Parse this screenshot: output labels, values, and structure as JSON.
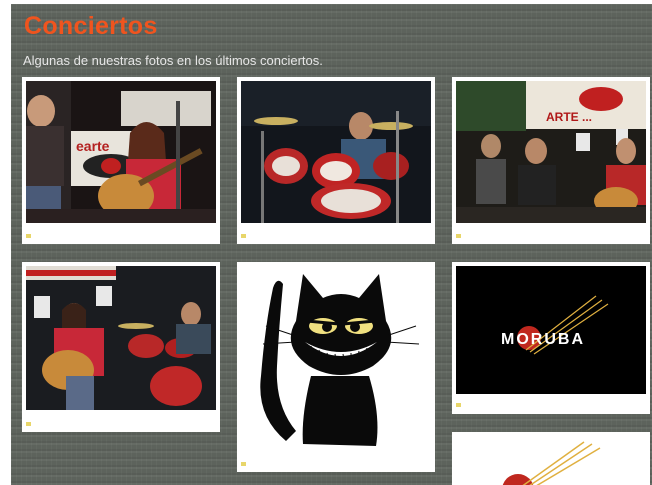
{
  "header": {
    "title": "Conciertos",
    "subtitle": "Algunas de nuestras fotos en los últimos conciertos."
  },
  "gallery": {
    "photos": [
      {
        "label": "concert-photo-guitarists",
        "banner_text": "earte"
      },
      {
        "label": "concert-photo-drummer"
      },
      {
        "label": "concert-photo-band-stage",
        "banner_text": "ARTE ..."
      },
      {
        "label": "concert-photo-singer-guitar"
      },
      {
        "label": "cat-illustration"
      },
      {
        "label": "moruba-logo",
        "logo_text": "MORUBA"
      },
      {
        "label": "moruba-logo-partial"
      }
    ]
  },
  "colors": {
    "title": "#f0541e",
    "background": "#5d635c",
    "card": "#ffffff",
    "accent_red": "#c0281f"
  }
}
